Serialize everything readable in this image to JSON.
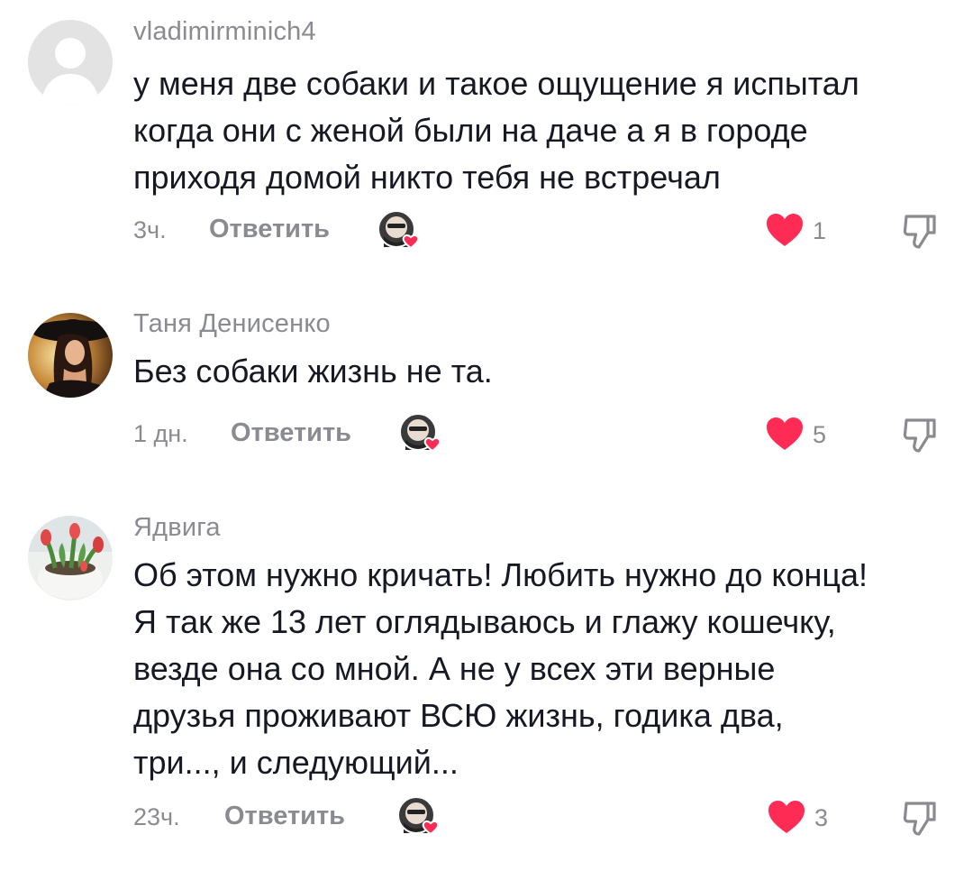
{
  "colors": {
    "heart": "#fe2c55",
    "secondary_text": "#8a8b91",
    "primary_text": "#161823",
    "background": "#ffffff"
  },
  "icons": {
    "like": "heart-icon",
    "dislike": "thumbs-down-icon",
    "creator_like": "creator-liked-avatar-icon"
  },
  "comments": [
    {
      "username": "vladimirminich4",
      "text": "у меня две собаки и такое ощущение я испытал\nкогда они с женой были на даче а я в городе\nприходя домой никто тебя не встречал",
      "time": "3ч.",
      "reply_label": "Ответить",
      "likes": "1",
      "avatar": "default-avatar"
    },
    {
      "username": "Таня Денисенко",
      "text": "Без собаки жизнь не та.",
      "time": "1 дн.",
      "reply_label": "Ответить",
      "likes": "5",
      "avatar": "woman-in-hat-photo"
    },
    {
      "username": "Ядвига",
      "text": "Об этом нужно кричать! Любить нужно до конца!\nЯ так же 13 лет оглядываюсь и глажу кошечку,\nвезде она со мной. А не у всех эти верные\nдрузья проживают ВСЮ жизнь, годика два,\nтри..., и следующий...",
      "time": "23ч.",
      "reply_label": "Ответить",
      "likes": "3",
      "avatar": "tulips-photo"
    }
  ]
}
